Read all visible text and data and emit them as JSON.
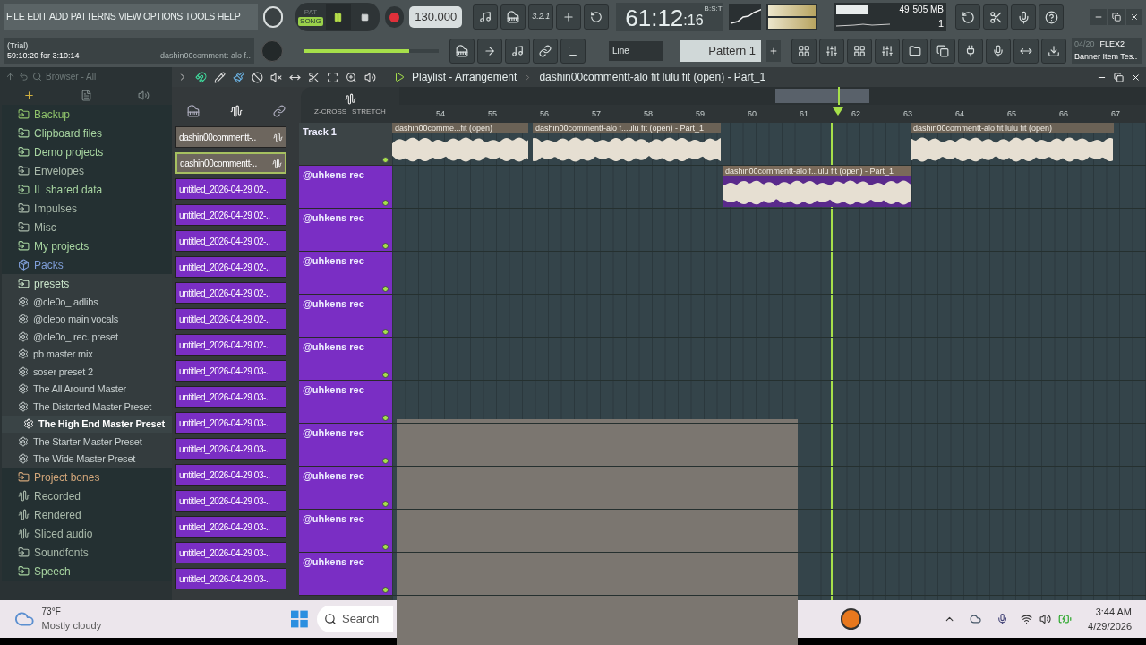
{
  "menu": [
    "FILE",
    "EDIT",
    "ADD",
    "PATTERNS",
    "VIEW",
    "OPTIONS",
    "TOOLS",
    "HELP"
  ],
  "hint": {
    "line1": "(Trial)",
    "line2": "59:10:20 for 3:10:14",
    "project": "dashin00commentt-alo f.."
  },
  "transport": {
    "modes": [
      {
        "label": "PAT",
        "selected": false
      },
      {
        "label": "SONG",
        "selected": true
      }
    ],
    "playing": true,
    "tempo": "130.000",
    "countdown": "3.2.1",
    "time": "61:12",
    "time_ticks": ":16",
    "time_format": "B:S:T",
    "master_volume": {
      "level": 0.78
    }
  },
  "monitor": {
    "cpu": "49",
    "memory": "505 MB",
    "polyphony": "1"
  },
  "snap": "Line",
  "pattern": "Pattern 1",
  "news": {
    "count": "04/20",
    "title": "FLEX2",
    "subtitle": "Banner Item Tes.."
  },
  "browser": {
    "title": "Browser - All",
    "items": [
      {
        "label": "Backup",
        "kind": "folder",
        "color": "#8fc26a"
      },
      {
        "label": "Clipboard files",
        "kind": "folder",
        "color": "#a7d4a0"
      },
      {
        "label": "Demo projects",
        "kind": "folder",
        "color": "#a7d4a0"
      },
      {
        "label": "Envelopes",
        "kind": "folder",
        "color": "#a9b9aa"
      },
      {
        "label": "IL shared data",
        "kind": "folder",
        "color": "#a7d4a0"
      },
      {
        "label": "Impulses",
        "kind": "folder",
        "color": "#a9b9aa"
      },
      {
        "label": "Misc",
        "kind": "folder",
        "color": "#a9b9aa"
      },
      {
        "label": "My projects",
        "kind": "folder",
        "color": "#a7d4a0"
      },
      {
        "label": "Packs",
        "kind": "pack",
        "color": "#7f9ed8"
      },
      {
        "label": "presets",
        "kind": "folder",
        "color": "#c9e4c9",
        "expanded": true,
        "children": [
          {
            "label": "@cle0o_ adlibs",
            "selected": false
          },
          {
            "label": "@cleoo main vocals",
            "selected": false
          },
          {
            "label": "@cle0o_ rec. preset",
            "selected": false
          },
          {
            "label": "pb master mix",
            "selected": false
          },
          {
            "label": "soser preset 2",
            "selected": false
          },
          {
            "label": "The All Around Master",
            "selected": false
          },
          {
            "label": "The Distorted Master Preset",
            "selected": false
          },
          {
            "label": "The High End Master Preset",
            "selected": true
          },
          {
            "label": "The Starter Master Preset",
            "selected": false
          },
          {
            "label": "The Wide Master Preset",
            "selected": false
          }
        ]
      },
      {
        "label": "Project bones",
        "kind": "folder",
        "color": "#d2a67a"
      },
      {
        "label": "Recorded",
        "kind": "audio",
        "color": "#a9b9aa"
      },
      {
        "label": "Rendered",
        "kind": "audio",
        "color": "#a9b9aa"
      },
      {
        "label": "Sliced audio",
        "kind": "audio",
        "color": "#a9b9aa"
      },
      {
        "label": "Soundfonts",
        "kind": "folder",
        "color": "#a9b9aa"
      },
      {
        "label": "Speech",
        "kind": "folder",
        "color": "#a7d4a0"
      }
    ]
  },
  "playlist": {
    "title": "Playlist - Arrangement",
    "clip_name": "dashin00commentt-alo fit lulu fit (open) - Part_1",
    "zcross": "Z-CROSS",
    "stretch": "STRETCH",
    "ruler": [
      "54",
      "55",
      "56",
      "57",
      "58",
      "59",
      "60",
      "61",
      "62",
      "63",
      "64",
      "65",
      "66",
      "67"
    ]
  },
  "channels": [
    {
      "label": "dashin00commentt-..",
      "kind": "audio",
      "selected": false
    },
    {
      "label": "dashin00commentt-..",
      "kind": "audio",
      "selected": true
    },
    {
      "label": "untitled_2026-04-29 02-..",
      "kind": "pattern",
      "selected": false
    },
    {
      "label": "untitled_2026-04-29 02-..",
      "kind": "pattern",
      "selected": false
    },
    {
      "label": "untitled_2026-04-29 02-..",
      "kind": "pattern",
      "selected": false
    },
    {
      "label": "untitled_2026-04-29 02-..",
      "kind": "pattern",
      "selected": false
    },
    {
      "label": "untitled_2026-04-29 02-..",
      "kind": "pattern",
      "selected": false
    },
    {
      "label": "untitled_2026-04-29 02-..",
      "kind": "pattern",
      "selected": false
    },
    {
      "label": "untitled_2026-04-29 02-..",
      "kind": "pattern",
      "selected": false
    },
    {
      "label": "untitled_2026-04-29 03-..",
      "kind": "pattern",
      "selected": false
    },
    {
      "label": "untitled_2026-04-29 03-..",
      "kind": "pattern",
      "selected": false
    },
    {
      "label": "untitled_2026-04-29 03-..",
      "kind": "pattern",
      "selected": false
    },
    {
      "label": "untitled_2026-04-29 03-..",
      "kind": "pattern",
      "selected": false
    },
    {
      "label": "untitled_2026-04-29 03-..",
      "kind": "pattern",
      "selected": false
    },
    {
      "label": "untitled_2026-04-29 03-..",
      "kind": "pattern",
      "selected": false
    },
    {
      "label": "untitled_2026-04-29 03-..",
      "kind": "pattern",
      "selected": false
    },
    {
      "label": "untitled_2026-04-29 03-..",
      "kind": "pattern",
      "selected": false
    },
    {
      "label": "untitled_2026-04-29 03-..",
      "kind": "pattern",
      "selected": false
    }
  ],
  "tracks": [
    {
      "name": "Track 1",
      "kind": "plain",
      "clips": [
        {
          "label": "dashin00comme...fit (open)",
          "selected": false
        },
        {
          "label": "dashin00commentt-alo f...ulu fit (open) - Part_1",
          "selected": false
        },
        {
          "label": "dashin00commentt-alo fit lulu fit (open)",
          "selected": false
        }
      ]
    },
    {
      "name": "@uhkens rec",
      "kind": "colored",
      "clips": [
        {
          "label": "dashin00commentt-alo f...ulu fit (open) - Part_1",
          "selected": true
        }
      ]
    },
    {
      "name": "@uhkens rec",
      "kind": "colored"
    },
    {
      "name": "@uhkens rec",
      "kind": "colored"
    },
    {
      "name": "@uhkens rec",
      "kind": "colored"
    },
    {
      "name": "@uhkens rec",
      "kind": "colored"
    },
    {
      "name": "@uhkens rec",
      "kind": "colored"
    },
    {
      "name": "@uhkens rec",
      "kind": "colored"
    },
    {
      "name": "@uhkens rec",
      "kind": "colored"
    },
    {
      "name": "@uhkens rec",
      "kind": "colored"
    },
    {
      "name": "@uhkens rec",
      "kind": "colored"
    }
  ],
  "taskbar": {
    "temperature": "73°F",
    "weather": "Mostly cloudy",
    "search": "Search",
    "time": "3:44 AM",
    "date": "4/29/2026"
  }
}
